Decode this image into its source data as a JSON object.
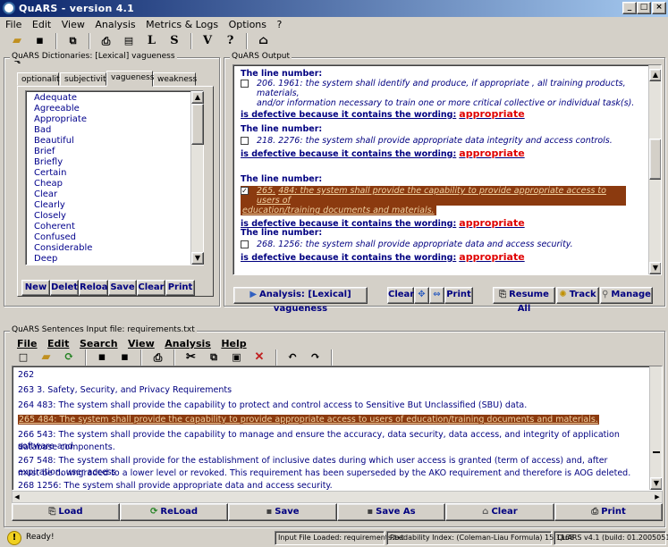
{
  "window": {
    "title": "QuARS  - version 4.1",
    "controls": [
      "_",
      "□",
      "×"
    ]
  },
  "menu": [
    "File",
    "Edit",
    "View",
    "Analysis",
    "Metrics & Logs",
    "Options",
    "?"
  ],
  "toolbar": {
    "letters": [
      "L",
      "S",
      "V",
      "?",
      "Q"
    ]
  },
  "dictionaries": {
    "title": "QuARS Dictionaries: [Lexical] vagueness",
    "tabs": [
      "optionality",
      "subjectivity",
      "vagueness",
      "weakness"
    ],
    "active_tab": "vagueness",
    "items": [
      "Adequate",
      "Agreeable",
      "Appropriate",
      "Bad",
      "Beautiful",
      "Brief",
      "Briefly",
      "Certain",
      "Cheap",
      "Clear",
      "Clearly",
      "Closely",
      "Coherent",
      "Confused",
      "Considerable",
      "Deep"
    ],
    "buttons": [
      "New",
      "Delete",
      "Reload",
      "Save",
      "Clear",
      "Print"
    ]
  },
  "output": {
    "title": "QuARS Output",
    "line_label": "The line number:",
    "defect_label": "is defective because it contains the wording:",
    "first_sentence": "and/or information necessary to train one or more critical collective or individual task(s).",
    "entries": [
      {
        "num": "206. 1961:",
        "text": "the system shall identify and produce, if appropriate , all training products, materials,",
        "word": "appropriate",
        "checked": false,
        "highlight": false
      },
      {
        "num": "218. 2276:",
        "text": "the system shall provide appropriate data integrity and access controls.",
        "word": "appropriate",
        "checked": false,
        "highlight": false
      },
      {
        "num": "265.",
        "text": "484: the system shall provide the capability to provide appropriate access to users of",
        "text2": "education/training documents and materials.",
        "word": "appropriate",
        "checked": true,
        "highlight": true
      },
      {
        "num": "268. 1256:",
        "text": "the system shall provide appropriate data and access security.",
        "word": "appropriate",
        "checked": false,
        "highlight": false
      }
    ],
    "buttons": {
      "analysis": "Analysis: [Lexical] vagueness",
      "clear": "Clear",
      "print": "Print",
      "resume_all": "Resume All",
      "track": "Track",
      "manage": "Manage"
    }
  },
  "sentences": {
    "title": "QuARS Sentences Input file: requirements.txt",
    "menu": [
      "File",
      "Edit",
      "Search",
      "View",
      "Analysis",
      "Help"
    ],
    "lines": [
      "262",
      "263 3. Safety, Security, and Privacy Requirements",
      "264 483: The system shall provide the capability to protect and control access to Sensitive But Unclassified (SBU) data.",
      "265 484: The system shall provide the capability to provide appropriate access to users of education/training documents and  materials.",
      "266 543: The system shall provide the capability to manage and ensure the accuracy, data security, data access, and integrity of application software and",
      "  database components.",
      "267 548: The system shall provide for the establishment of inclusive dates during which user access is granted (term of access) and, after expiration, user access",
      "  must be downgraded to a lower level or revoked.  This requirement has been superseded by the AKO requirement and therefore is AOG deleted.",
      "268 1256: The system shall provide appropriate data and access security."
    ],
    "highlight_line": 3,
    "buttons": [
      "Load",
      "ReLoad",
      "Save",
      "Save As",
      "Clear",
      "Print"
    ]
  },
  "status": {
    "ready": "Ready!",
    "file": "Input File Loaded: requirements.txt",
    "readability": "Readability Index: (Coleman-Liau Formula) 15.1168",
    "version": "QuARS v4.1 (build: 01.20050510)"
  }
}
